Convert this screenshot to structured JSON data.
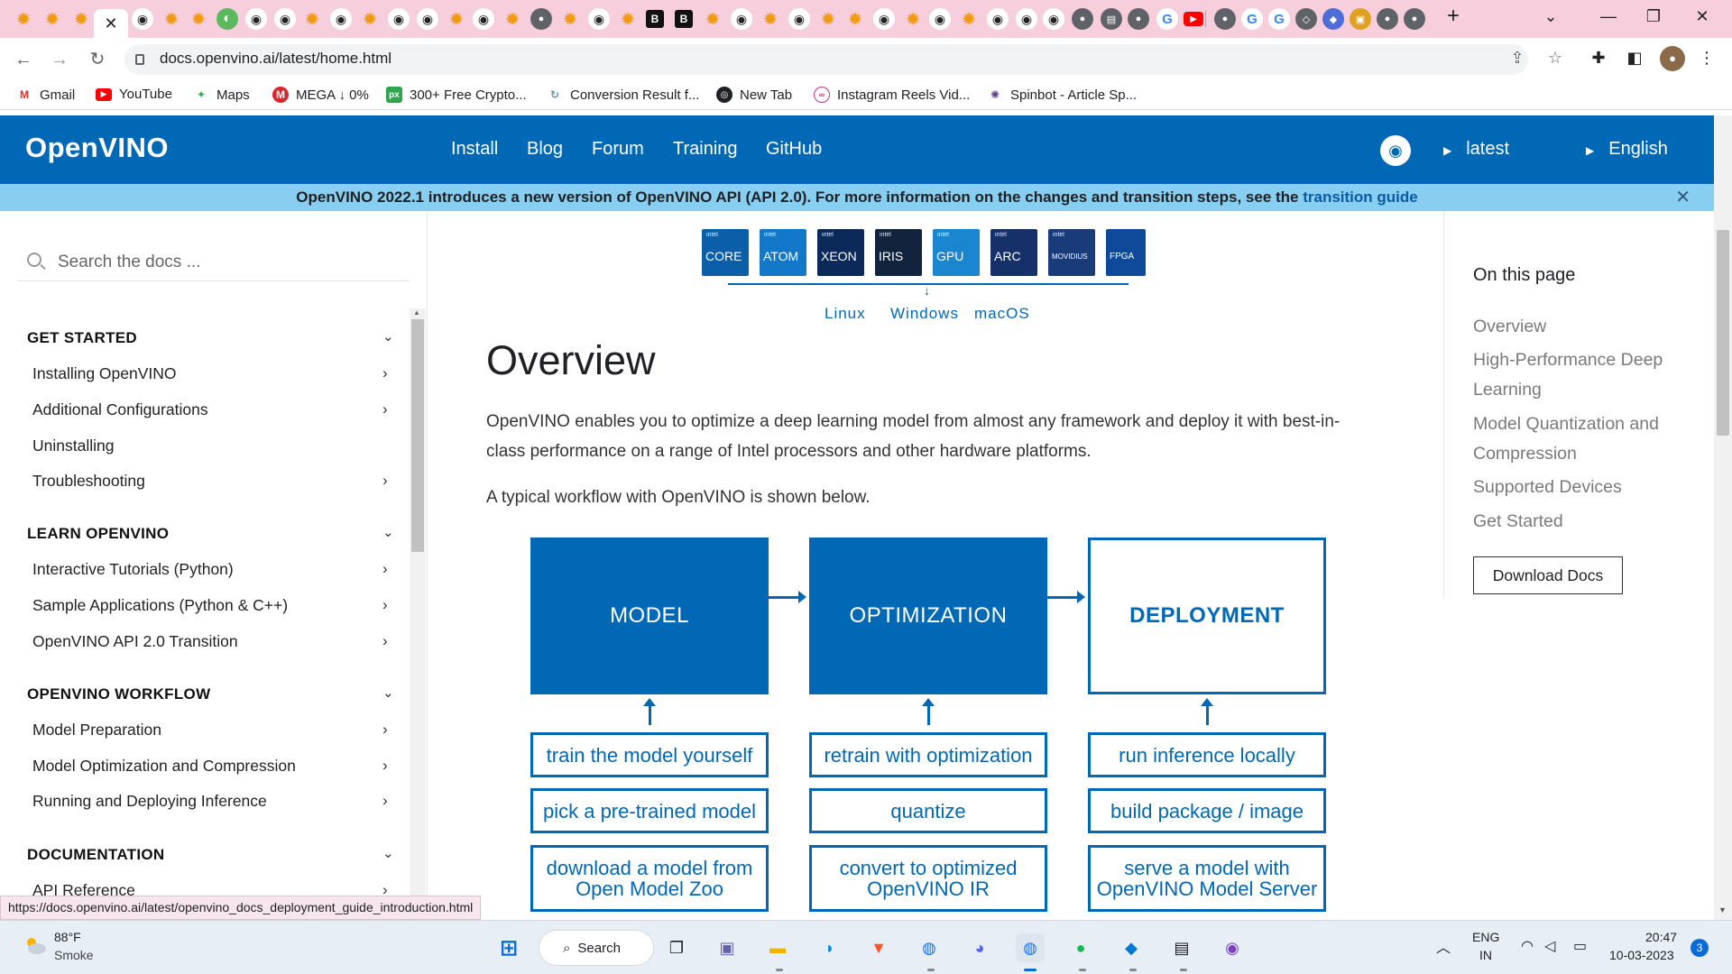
{
  "browser": {
    "url": "docs.openvino.ai/latest/home.html",
    "bookmarks": [
      {
        "label": "Gmail",
        "icon": "gmail-icon"
      },
      {
        "label": "YouTube",
        "icon": "youtube-icon"
      },
      {
        "label": "Maps",
        "icon": "maps-icon"
      },
      {
        "label": "MEGA ↓ 0%",
        "icon": "mega-icon"
      },
      {
        "label": "300+ Free Crypto...",
        "icon": "px-icon"
      },
      {
        "label": "Conversion Result f...",
        "icon": "conversion-icon"
      },
      {
        "label": "New Tab",
        "icon": "globe-icon"
      },
      {
        "label": "Instagram Reels Vid...",
        "icon": "instagram-icon"
      },
      {
        "label": "Spinbot - Article Sp...",
        "icon": "spinbot-icon"
      }
    ],
    "active_tab_close": "✕",
    "new_tab": "+"
  },
  "site": {
    "logo": "OpenVINO",
    "nav": [
      "Install",
      "Blog",
      "Forum",
      "Training",
      "GitHub"
    ],
    "version": "latest",
    "language": "English",
    "banner_text": "OpenVINO 2022.1 introduces a new version of OpenVINO API (API 2.0). For more information on the changes and transition steps, see the ",
    "banner_link": "transition guide"
  },
  "sidebar": {
    "search_placeholder": "Search the docs ...",
    "sections": [
      {
        "title": "GET STARTED",
        "items": [
          "Installing OpenVINO",
          "Additional Configurations",
          "Uninstalling",
          "Troubleshooting"
        ]
      },
      {
        "title": "LEARN OPENVINO",
        "items": [
          "Interactive Tutorials (Python)",
          "Sample Applications (Python & C++)",
          "OpenVINO API 2.0 Transition"
        ]
      },
      {
        "title": "OPENVINO WORKFLOW",
        "items": [
          "Model Preparation",
          "Model Optimization and Compression",
          "Running and Deploying Inference"
        ]
      },
      {
        "title": "DOCUMENTATION",
        "items": [
          "API Reference"
        ]
      }
    ]
  },
  "main": {
    "hardware_chips": [
      {
        "brand": "intel",
        "name": "CORE",
        "color": "#0a5fa8"
      },
      {
        "brand": "intel",
        "name": "ATOM",
        "color": "#1478c8"
      },
      {
        "brand": "intel",
        "name": "XEON",
        "color": "#0b2a5a"
      },
      {
        "brand": "intel",
        "name": "IRIS",
        "color": "#12233d"
      },
      {
        "brand": "intel",
        "name": "GPU",
        "color": "#1a86d0"
      },
      {
        "brand": "intel",
        "name": "ARC",
        "color": "#16306a"
      },
      {
        "brand": "intel",
        "name": "MOVIDIUS",
        "color": "#1a3b7a"
      },
      {
        "brand": "",
        "name": "FPGA",
        "color": "#0f4a9a"
      }
    ],
    "os_labels": [
      "Linux",
      "Windows",
      "macOS"
    ],
    "title": "Overview",
    "paragraph1": "OpenVINO enables you to optimize a deep learning model from almost any framework and deploy it with best-in-class performance on a range of Intel processors and other hardware platforms.",
    "paragraph2": "A typical workflow with OpenVINO is shown below.",
    "workflow": {
      "columns": [
        {
          "head": "MODEL",
          "boxes": [
            "train the model yourself",
            "pick a pre-trained model",
            "download a model from Open Model Zoo"
          ]
        },
        {
          "head": "OPTIMIZATION",
          "boxes": [
            "retrain with optimization",
            "quantize",
            "convert to optimized OpenVINO IR"
          ]
        },
        {
          "head": "DEPLOYMENT",
          "boxes": [
            "run inference locally",
            "build package / image",
            "serve a model with OpenVINO Model Server"
          ]
        }
      ]
    }
  },
  "toc": {
    "title": "On this page",
    "items": [
      "Overview",
      "High-Performance Deep Learning",
      "Model Quantization and Compression",
      "Supported Devices",
      "Get Started"
    ],
    "download_button": "Download Docs"
  },
  "status_url": "https://docs.openvino.ai/latest/openvino_docs_deployment_guide_introduction.html",
  "taskbar": {
    "weather_temp": "88°F",
    "weather_desc": "Smoke",
    "search_label": "Search",
    "lang_top": "ENG",
    "lang_bottom": "IN",
    "time": "20:47",
    "date": "10-03-2023",
    "notification_count": "3"
  }
}
